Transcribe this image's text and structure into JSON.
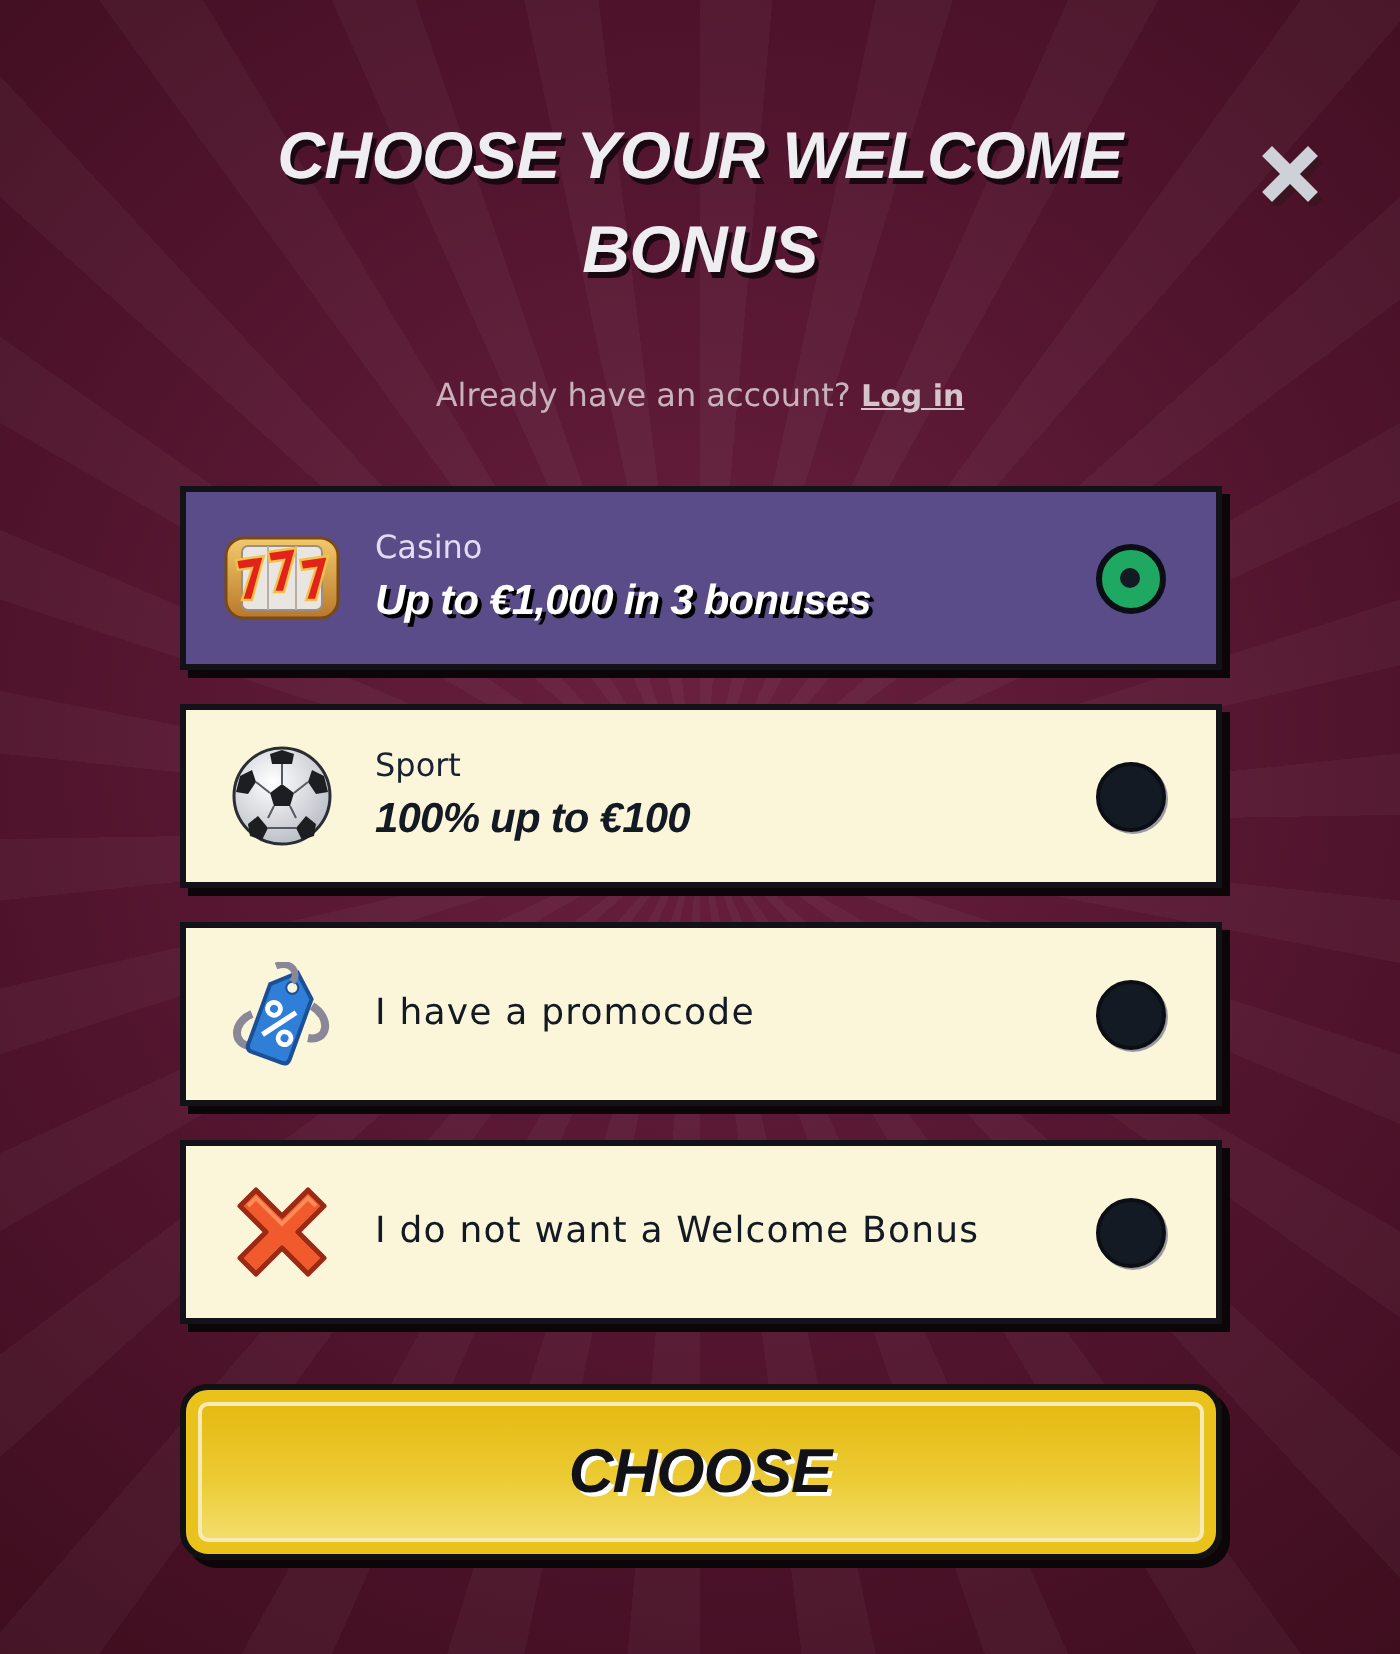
{
  "title": "CHOOSE YOUR WELCOME BONUS",
  "login_prompt": {
    "text": "Already have an account?",
    "link": "Log in"
  },
  "options": [
    {
      "kind": "casino",
      "label": "Casino",
      "offer": "Up to €1,000 in 3 bonuses",
      "selected": true
    },
    {
      "kind": "sport",
      "label": "Sport",
      "offer": "100% up to €100",
      "selected": false
    },
    {
      "kind": "promocode",
      "label": "I have a promocode",
      "selected": false
    },
    {
      "kind": "decline",
      "label": "I do not want a Welcome Bonus",
      "selected": false
    }
  ],
  "submit_button": {
    "label": "CHOOSE"
  }
}
